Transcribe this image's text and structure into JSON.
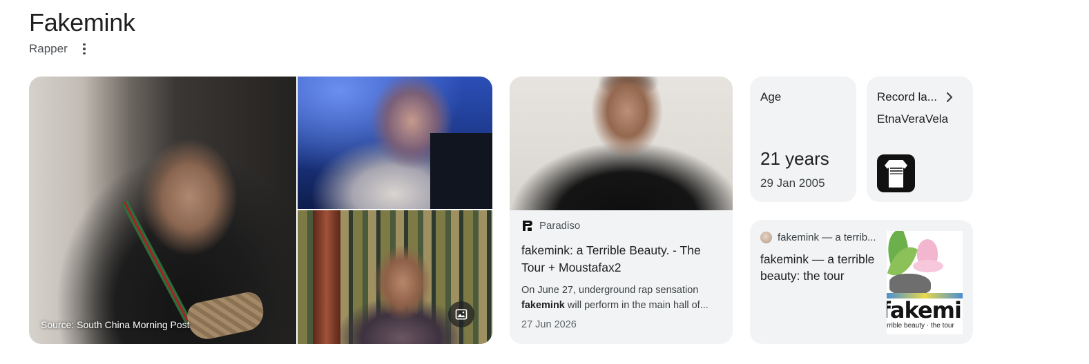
{
  "header": {
    "title": "Fakemink",
    "subtitle": "Rapper"
  },
  "images": {
    "source_caption": "Source: South China Morning Post"
  },
  "article": {
    "publisher": "Paradiso",
    "title": "fakemink: a Terrible Beauty. - The Tour + Moustafax2",
    "snippet_prefix": "On June 27, underground rap sensation ",
    "snippet_bold": "fakemink",
    "snippet_suffix": " will perform in the main hall of...",
    "date": "27 Jun 2026"
  },
  "age": {
    "label": "Age",
    "value": "21 years",
    "date": "29 Jan 2005"
  },
  "record_label": {
    "label": "Record la...",
    "value": "EtnaVeraVela"
  },
  "link_card": {
    "source": "fakemink — a terrib...",
    "title": "fakemink — a terrible beauty: the tour",
    "image_brand": "fakemink",
    "image_tagline": "rrible beauty · the tour"
  },
  "colors": {
    "card_bg": "#f1f3f4",
    "text_primary": "#1f1f1f",
    "text_secondary": "#4d5156"
  }
}
